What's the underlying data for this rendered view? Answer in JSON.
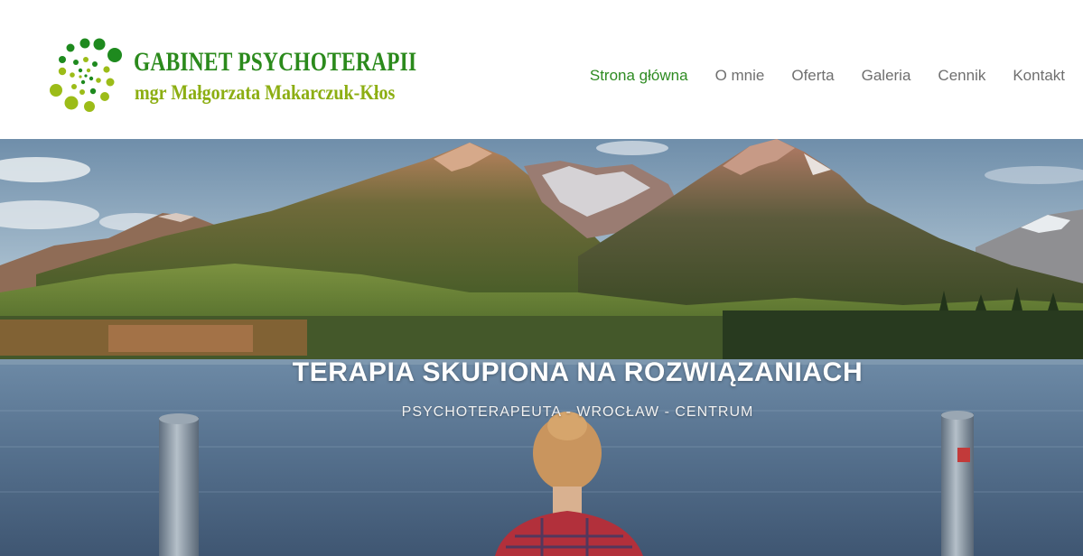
{
  "header": {
    "logo": {
      "title": "GABINET PSYCHOTERAPII",
      "subtitle": "mgr Małgorzata Makarczuk-Kłos",
      "icon": "dotted-spiral-logo",
      "colors": {
        "dark_green": "#1e8a1e",
        "light_green": "#9cbc18"
      }
    },
    "nav": {
      "items": [
        {
          "label": "Strona główna",
          "active": true
        },
        {
          "label": "O mnie",
          "active": false
        },
        {
          "label": "Oferta",
          "active": false
        },
        {
          "label": "Galeria",
          "active": false
        },
        {
          "label": "Cennik",
          "active": false
        },
        {
          "label": "Kontakt",
          "active": false
        }
      ],
      "colors": {
        "active": "#2e8b22",
        "default": "#6f6f6f"
      }
    }
  },
  "hero": {
    "title": "TERAPIA SKUPIONA NA ROZWIĄZANIACH",
    "subtitle": "PSYCHOTERAPEUTA - WROCŁAW - CENTRUM",
    "image": "mountain-lake-landscape-photo"
  }
}
